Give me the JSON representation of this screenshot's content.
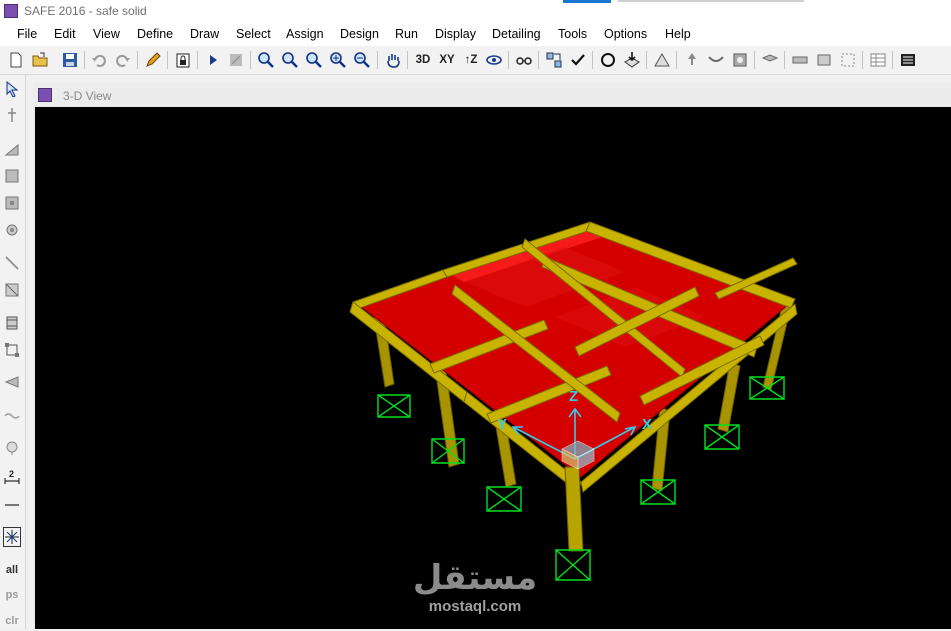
{
  "app": {
    "title": "SAFE 2016 - safe  solid"
  },
  "menu": [
    "File",
    "Edit",
    "View",
    "Define",
    "Draw",
    "Select",
    "Assign",
    "Design",
    "Run",
    "Display",
    "Detailing",
    "Tools",
    "Options",
    "Help"
  ],
  "toolbar": {
    "text_buttons": {
      "view3d": "3D",
      "viewxy": "XY",
      "viewz": "↑Z"
    },
    "icons": [
      "new-file-icon",
      "open-folder-icon",
      "save-icon",
      "undo-icon",
      "redo-icon",
      "pencil-icon",
      "lock-icon",
      "run-icon",
      "run-disabled-icon",
      "zoom-window-icon",
      "zoom-fit-icon",
      "zoom-previous-icon",
      "zoom-in-icon",
      "zoom-out-icon",
      "pan-hand-icon",
      "view-3d",
      "view-xy",
      "view-z",
      "rotate-icon",
      "perspective-glasses-icon",
      "select-icon",
      "check-icon",
      "circle-icon",
      "load-icon",
      "triangle-icon",
      "support-icon",
      "deformed-shape-icon",
      "gear-icon",
      "strip-icon",
      "beam-icon",
      "slab-icon",
      "tendon-icon",
      "table-icon",
      "report-icon"
    ]
  },
  "left_toolbar": {
    "labels": {
      "dim": "2",
      "all": "all",
      "ps": "ps",
      "clr": "clr"
    }
  },
  "view": {
    "title": "3-D View",
    "axes": {
      "x": "X",
      "y": "Y",
      "z": "Z"
    },
    "watermark": {
      "arabic": "مستقل",
      "url": "mostaql.com"
    }
  },
  "colors": {
    "slab": "#d40000",
    "beam": "#c8b400",
    "support": "#00e020",
    "axis": "#39c8e8",
    "background": "#000000"
  }
}
